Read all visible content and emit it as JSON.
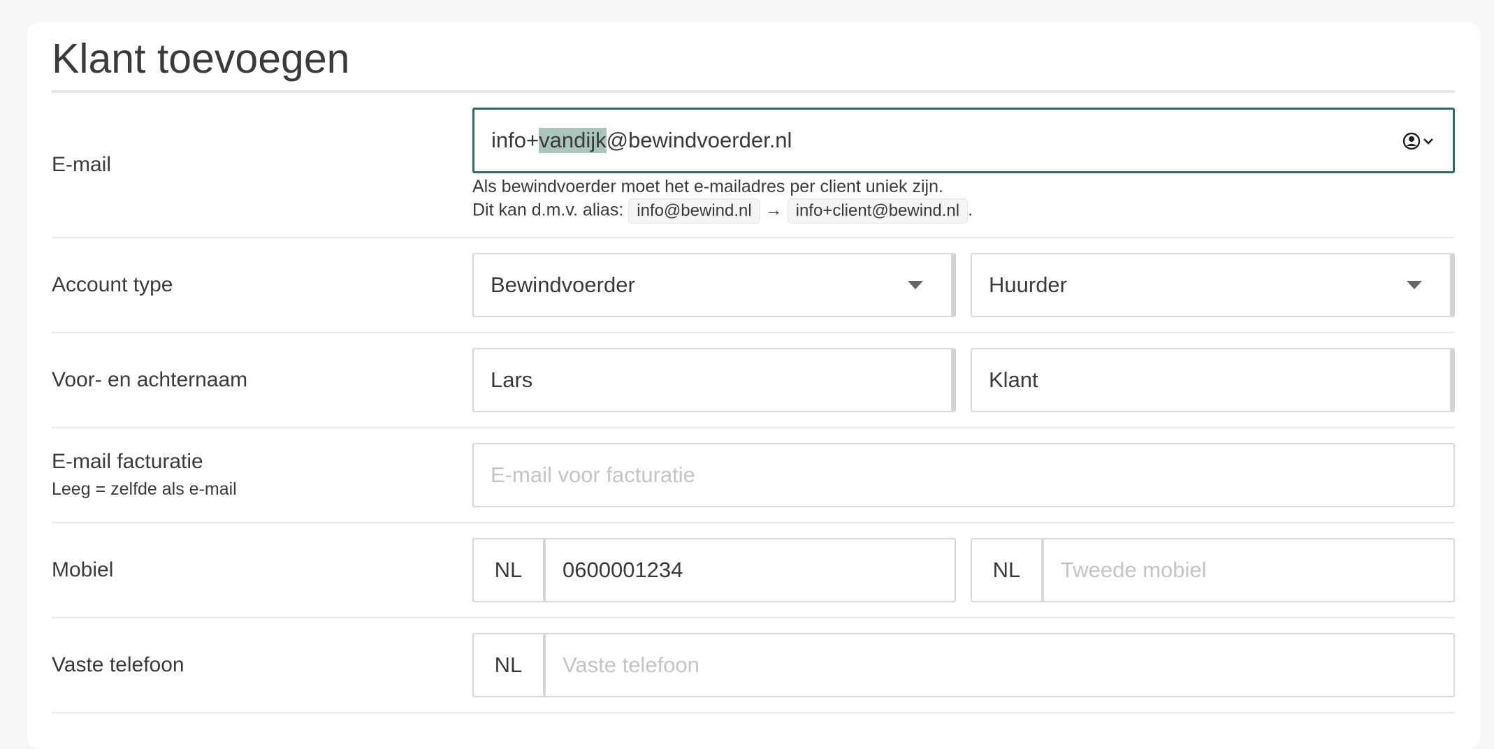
{
  "page": {
    "title": "Klant toevoegen"
  },
  "email": {
    "label": "E-mail",
    "value_prefix": "info+",
    "value_selected": "vandijk",
    "value_suffix": "@bewindvoerder.nl",
    "help_line1": "Als bewindvoerder moet het e-mailadres per client uniek zijn.",
    "help_line2_prefix": "Dit kan d.m.v. alias:",
    "alias_from": "info@bewind.nl",
    "arrow": "→",
    "alias_to": "info+client@bewind.nl",
    "help_line2_suffix": ".",
    "icon": "account-circle-icon"
  },
  "account_type": {
    "label": "Account type",
    "select1_value": "Bewindvoerder",
    "select2_value": "Huurder"
  },
  "name": {
    "label": "Voor- en achternaam",
    "first_value": "Lars",
    "last_value": "Klant"
  },
  "billing_email": {
    "label": "E-mail facturatie",
    "sublabel": "Leeg = zelfde als e-mail",
    "placeholder": "E-mail voor facturatie"
  },
  "mobile": {
    "label": "Mobiel",
    "country1": "NL",
    "value1": "0600001234",
    "country2": "NL",
    "placeholder2": "Tweede mobiel"
  },
  "landline": {
    "label": "Vaste telefoon",
    "country": "NL",
    "placeholder": "Vaste telefoon"
  },
  "colors": {
    "focus_border": "#2f6e64",
    "selection_highlight": "#a9c5be"
  }
}
